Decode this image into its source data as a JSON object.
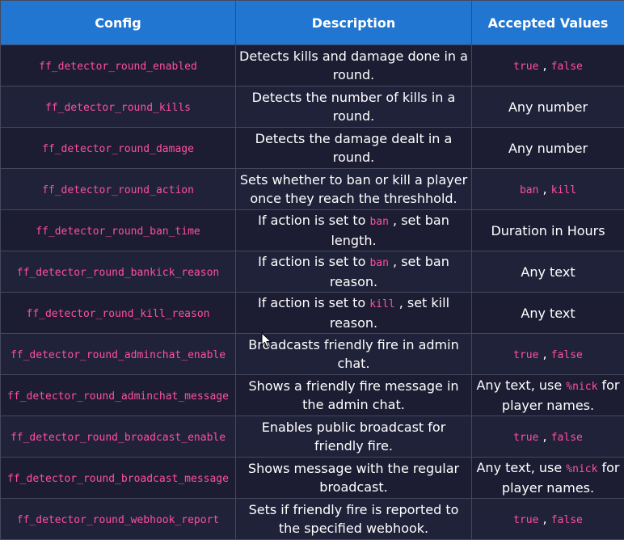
{
  "table": {
    "headers": [
      "Config",
      "Description",
      "Accepted Values"
    ],
    "rows": [
      {
        "config": "ff_detector_round_enabled",
        "description": "Detects kills and damage done in a round.",
        "values_kind": "codes",
        "values_codes": [
          "true",
          "false"
        ]
      },
      {
        "config": "ff_detector_round_kills",
        "description": "Detects the number of kills in a round.",
        "values_kind": "text",
        "values_text": "Any number"
      },
      {
        "config": "ff_detector_round_damage",
        "description": "Detects the damage dealt in a round.",
        "values_kind": "text",
        "values_text": "Any number"
      },
      {
        "config": "ff_detector_round_action",
        "description": "Sets whether to ban or kill a player once they reach the threshhold.",
        "values_kind": "codes",
        "values_codes": [
          "ban",
          "kill"
        ]
      },
      {
        "config": "ff_detector_round_ban_time",
        "description_parts": [
          "If action is set to ",
          "ban",
          " , set ban length."
        ],
        "values_kind": "text",
        "values_text": "Duration in Hours"
      },
      {
        "config": "ff_detector_round_bankick_reason",
        "description_parts": [
          "If action is set to ",
          "ban",
          " , set ban reason."
        ],
        "values_kind": "text",
        "values_text": "Any text"
      },
      {
        "config": "ff_detector_round_kill_reason",
        "description_parts": [
          "If action is set to ",
          "kill",
          " , set kill reason."
        ],
        "values_kind": "text",
        "values_text": "Any text"
      },
      {
        "config": "ff_detector_round_adminchat_enable",
        "description": "Broadcasts friendly fire in admin chat.",
        "values_kind": "codes",
        "values_codes": [
          "true",
          "false"
        ]
      },
      {
        "config": "ff_detector_round_adminchat_message",
        "description": "Shows a friendly fire message in the admin chat.",
        "values_kind": "mixed",
        "values_parts": [
          "Any text, use ",
          "%nick",
          " for player names."
        ]
      },
      {
        "config": "ff_detector_round_broadcast_enable",
        "description": "Enables public broadcast for friendly fire.",
        "values_kind": "codes",
        "values_codes": [
          "true",
          "false"
        ]
      },
      {
        "config": "ff_detector_round_broadcast_message",
        "description": "Shows message with the regular broadcast.",
        "values_kind": "mixed",
        "values_parts": [
          "Any text, use ",
          "%nick",
          " for player names."
        ]
      },
      {
        "config": "ff_detector_round_webhook_report",
        "description": "Sets if friendly fire is reported to the specified webhook.",
        "values_kind": "codes",
        "values_codes": [
          "true",
          "false"
        ]
      }
    ]
  },
  "colors": {
    "header_bg": "#2176d2",
    "row_bg": "#1c1d33",
    "code_text": "#ff4fa0",
    "border": "#45485c"
  },
  "cursor": {
    "icon": "mouse-pointer-icon"
  }
}
